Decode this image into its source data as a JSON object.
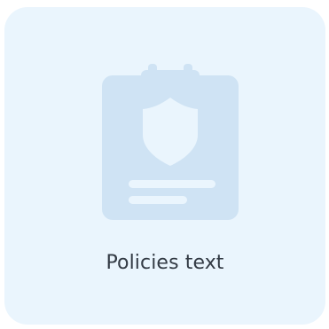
{
  "card": {
    "label": "Policies text",
    "icon": "policy-document-icon",
    "background_color": "#eaf5fd",
    "icon_color": "#cfe3f4"
  }
}
